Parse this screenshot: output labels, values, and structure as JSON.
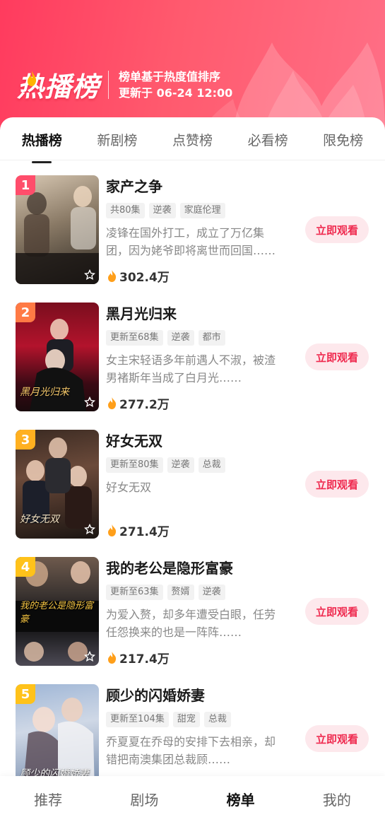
{
  "header": {
    "brand_title": "热播榜",
    "subtitle_line1": "榜单基于热度值排序",
    "subtitle_line2": "更新于 06-24 12:00"
  },
  "tabs": [
    {
      "label": "热播榜",
      "active": true
    },
    {
      "label": "新剧榜",
      "active": false
    },
    {
      "label": "点赞榜",
      "active": false
    },
    {
      "label": "必看榜",
      "active": false
    },
    {
      "label": "限免榜",
      "active": false
    }
  ],
  "items": [
    {
      "rank": "1",
      "rank_color": "#ff4d6b",
      "title": "家产之争",
      "tags": [
        "共80集",
        "逆袭",
        "家庭伦理"
      ],
      "desc": "凌锋在国外打工，成立了万亿集团，因为姥爷即将离世而回国……",
      "heat": "302.4万",
      "button": "立即观看",
      "poster_text": "家产之争"
    },
    {
      "rank": "2",
      "rank_color": "#ff7a45",
      "title": "黑月光归来",
      "tags": [
        "更新至68集",
        "逆袭",
        "都市"
      ],
      "desc": "女主宋轻语多年前遇人不淑，被渣男褚斯年当成了白月光……",
      "heat": "277.2万",
      "button": "立即观看",
      "poster_text": "黑月光归来"
    },
    {
      "rank": "3",
      "rank_color": "#ffb020",
      "title": "好女无双",
      "tags": [
        "更新至80集",
        "逆袭",
        "总裁"
      ],
      "desc": "好女无双",
      "heat": "271.4万",
      "button": "立即观看",
      "poster_text": "好女无双"
    },
    {
      "rank": "4",
      "rank_color": "#ffc21a",
      "title": "我的老公是隐形富豪",
      "tags": [
        "更新至63集",
        "赘婿",
        "逆袭"
      ],
      "desc": "为爱入赘，却多年遭受白眼，任劳任怨换来的也是一阵阵……",
      "heat": "217.4万",
      "button": "立即观看",
      "poster_text": "我的老公是隐形富豪"
    },
    {
      "rank": "5",
      "rank_color": "#ffc21a",
      "title": "顾少的闪婚娇妻",
      "tags": [
        "更新至104集",
        "甜宠",
        "总裁"
      ],
      "desc": "乔夏夏在乔母的安排下去相亲，却错把南澳集团总裁顾……",
      "heat": "",
      "button": "立即观看",
      "poster_text": "顾少的闪婚娇妻"
    }
  ],
  "bottom_nav": [
    {
      "label": "推荐",
      "active": false
    },
    {
      "label": "剧场",
      "active": false
    },
    {
      "label": "榜单",
      "active": true
    },
    {
      "label": "我的",
      "active": false
    }
  ]
}
